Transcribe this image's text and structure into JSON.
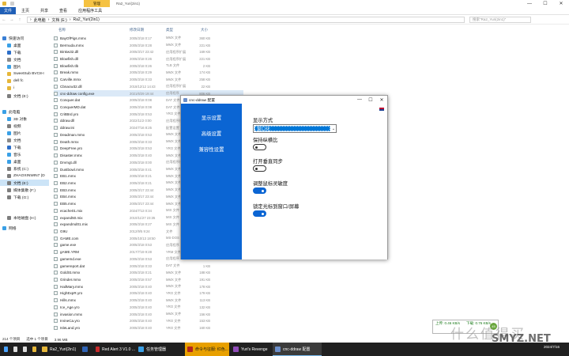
{
  "explorer": {
    "titlebar": {
      "context_tab": "管理",
      "title": "Ra2_Yuri(2in1)",
      "buttons": [
        "—",
        "☐",
        "✕"
      ]
    },
    "ribbon_tabs": [
      "文件",
      "主页",
      "共享",
      "查看",
      "应用程序工具"
    ],
    "address": {
      "back": "←",
      "forward": "→",
      "up": "↑",
      "crumbs": [
        "›",
        "此电脑",
        "›",
        "文档 (E:)",
        "›",
        "Ra2_Yuri(2in1)"
      ],
      "search_placeholder": "搜索\"Ra2_Yuri(2in1)\""
    },
    "columns": {
      "name": "名称",
      "date": "修改日期",
      "type": "类型",
      "size": "大小"
    },
    "nav": [
      {
        "label": "快速访问",
        "icon": "star-icon",
        "color": "#3a7fd5"
      },
      {
        "label": "桌面",
        "icon": "desktop-icon",
        "color": "#3aa0e6"
      },
      {
        "label": "下载",
        "icon": "download-icon",
        "color": "#2d6fc9"
      },
      {
        "label": "文档",
        "icon": "document-icon",
        "color": "#8a8a8a"
      },
      {
        "label": "图片",
        "icon": "picture-icon",
        "color": "#3aa0e6"
      },
      {
        "label": "SweetSub BVC8-I",
        "icon": "folder-icon",
        "color": "#e6b73a"
      },
      {
        "label": "dell fc",
        "icon": "folder-icon",
        "color": "#e6b73a"
      },
      {
        "label": "i",
        "icon": "folder-icon",
        "color": "#e6b73a"
      },
      {
        "label": "文档 (E:)",
        "icon": "drive-icon",
        "color": "#7d7d7d"
      },
      {
        "label": "此电脑",
        "icon": "computer-icon",
        "color": "#3aa0e6"
      },
      {
        "label": "3D 对象",
        "icon": "cube-icon",
        "color": "#3aa0e6"
      },
      {
        "label": "视频",
        "icon": "video-icon",
        "color": "#7d7d7d"
      },
      {
        "label": "图片",
        "icon": "picture-icon",
        "color": "#3aa0e6"
      },
      {
        "label": "文档",
        "icon": "document-icon",
        "color": "#8a8a8a"
      },
      {
        "label": "下载",
        "icon": "download-icon",
        "color": "#2d6fc9"
      },
      {
        "label": "音乐",
        "icon": "music-icon",
        "color": "#3aa0e6"
      },
      {
        "label": "桌面",
        "icon": "desktop-icon",
        "color": "#3aa0e6"
      },
      {
        "label": "系统 (C:)",
        "icon": "drive-icon",
        "color": "#7d7d7d"
      },
      {
        "label": "ZHAOXINWIN7 (D",
        "icon": "drive-icon",
        "color": "#7d7d7d"
      },
      {
        "label": "文档 (E:)",
        "icon": "drive-icon",
        "color": "#7d7d7d"
      },
      {
        "label": "媒体集散 (F:)",
        "icon": "drive-icon",
        "color": "#7d7d7d"
      },
      {
        "label": "下载 (G:)",
        "icon": "drive-icon",
        "color": "#7d7d7d"
      },
      {
        "label": "本地磁盘 (H:)",
        "icon": "drive-icon",
        "color": "#7d7d7d"
      },
      {
        "label": "网络",
        "icon": "network-icon",
        "color": "#3aa0e6"
      }
    ],
    "files": [
      {
        "name": "BayOfPigs.mmx",
        "date": "2005/3/18 0:17",
        "type": "MMX 文件",
        "size": "360 KB"
      },
      {
        "name": "Bermuda.mmx",
        "date": "2005/3/18 0:28",
        "type": "MMX 文件",
        "size": "221 KB"
      },
      {
        "name": "Binkw32.dll",
        "date": "2005/3/17 23:42",
        "type": "应用程序扩展",
        "size": "169 KB"
      },
      {
        "name": "Blowfish.dll",
        "date": "2005/3/18 0:26",
        "type": "应用程序扩展",
        "size": "221 KB"
      },
      {
        "name": "Blowfish.tlb",
        "date": "2005/3/18 0:26",
        "type": "TLB 文件",
        "size": "2 KB"
      },
      {
        "name": "Break.mmx",
        "date": "2005/3/18 0:29",
        "type": "MMX 文件",
        "size": "174 KB"
      },
      {
        "name": "Carville.mmx",
        "date": "2005/3/18 0:33",
        "type": "MMX 文件",
        "size": "258 KB"
      },
      {
        "name": "Cbnacw32.dll",
        "date": "2018/12/12 14:43",
        "type": "应用程序扩展",
        "size": "22 KB"
      },
      {
        "name": "cnc-ddraw config.exe",
        "date": "2021/6/29 19:44",
        "type": "应用程序",
        "size": "806 KB"
      },
      {
        "name": "Conquer.dat",
        "date": "2005/3/18 0:08",
        "type": "DAT 文件",
        "size": ""
      },
      {
        "name": "ConquerMD.dat",
        "date": "2005/3/18 0:08",
        "type": "DAT 文件",
        "size": ""
      },
      {
        "name": "CrittBrd.yro",
        "date": "2005/3/18 0:53",
        "type": "YRO 文件",
        "size": ""
      },
      {
        "name": "ddraw.dll",
        "date": "2022/11/2 0:00",
        "type": "应用程序扩展",
        "size": ""
      },
      {
        "name": "ddraw.ini",
        "date": "2024/7/16 8:25",
        "type": "配置设置",
        "size": ""
      },
      {
        "name": "Deadman.mmx",
        "date": "2005/3/18 0:53",
        "type": "MMX 文件",
        "size": ""
      },
      {
        "name": "Death.mmx",
        "date": "2005/3/18 0:33",
        "type": "MMX 文件",
        "size": ""
      },
      {
        "name": "DeepFree.yro",
        "date": "2005/3/18 0:53",
        "type": "YRO 文件",
        "size": ""
      },
      {
        "name": "Disaster.mmx",
        "date": "2005/3/18 0:40",
        "type": "MMX 文件",
        "size": ""
      },
      {
        "name": "Drvmgt.dll",
        "date": "2005/3/18 0:00",
        "type": "应用程序扩展",
        "size": ""
      },
      {
        "name": "Dustbowl.mmx",
        "date": "2005/3/18 0:41",
        "type": "MMX 文件",
        "size": ""
      },
      {
        "name": "EB1.mmx",
        "date": "2005/3/18 0:21",
        "type": "MMX 文件",
        "size": ""
      },
      {
        "name": "EB2.mmx",
        "date": "2005/3/18 0:21",
        "type": "MMX 文件",
        "size": ""
      },
      {
        "name": "EB3.mmx",
        "date": "2005/3/17 23:44",
        "type": "MMX 文件",
        "size": ""
      },
      {
        "name": "EB4.mmx",
        "date": "2005/3/17 23:44",
        "type": "MMX 文件",
        "size": ""
      },
      {
        "name": "EB5.mmx",
        "date": "2005/3/17 23:44",
        "type": "MMX 文件",
        "size": ""
      },
      {
        "name": "ecache01.mix",
        "date": "2024/7/13 0:34",
        "type": "MIX 文件",
        "size": ""
      },
      {
        "name": "expand50.mix",
        "date": "2010/11/27 23:35",
        "type": "MIX 文件",
        "size": ""
      },
      {
        "name": "expandmd01.mix",
        "date": "2005/3/18 0:27",
        "type": "MIX 文件",
        "size": ""
      },
      {
        "name": "G9U",
        "date": "2012/9/5 9:24",
        "type": "文件",
        "size": ""
      },
      {
        "name": "GAME.com",
        "date": "2005/10/13 18:50",
        "type": "MS-DOS 应用程序",
        "size": ""
      },
      {
        "name": "game.exe",
        "date": "2005/3/18 0:53",
        "type": "应用程序",
        "size": ""
      },
      {
        "name": "gAME.YRM",
        "date": "2017/7/19 9:28",
        "type": "YRM 文件",
        "size": ""
      },
      {
        "name": "gamemd.exe",
        "date": "2005/3/18 0:53",
        "type": "应用程序",
        "size": ""
      },
      {
        "name": "gamereport.dat",
        "date": "2005/3/18 0:33",
        "type": "DAT 文件",
        "size": "1 KB"
      },
      {
        "name": "GoldSt.mmx",
        "date": "2005/3/18 0:21",
        "type": "MMX 文件",
        "size": "188 KB"
      },
      {
        "name": "Grinder.mmx",
        "date": "2005/3/18 0:57",
        "type": "MMX 文件",
        "size": "191 KB"
      },
      {
        "name": "HailMary.mmx",
        "date": "2005/3/18 0:40",
        "type": "MMX 文件",
        "size": "178 KB"
      },
      {
        "name": "HighExpR.yro",
        "date": "2005/3/18 0:40",
        "type": "YRO 文件",
        "size": "179 KB"
      },
      {
        "name": "Hills.mmx",
        "date": "2005/3/18 0:40",
        "type": "MMX 文件",
        "size": "113 KB"
      },
      {
        "name": "Ice_Age.yro",
        "date": "2005/3/18 0:40",
        "type": "YRO 文件",
        "size": "132 KB"
      },
      {
        "name": "invasion.mmx",
        "date": "2005/3/18 0:40",
        "type": "MMX 文件",
        "size": "156 KB"
      },
      {
        "name": "IrvineCa.yro",
        "date": "2005/3/18 0:40",
        "type": "YRO 文件",
        "size": "153 KB"
      },
      {
        "name": "IsleLand.yro",
        "date": "2005/3/18 0:40",
        "type": "YRO 文件",
        "size": "160 KB"
      }
    ],
    "status": {
      "count": "214 个项目",
      "selected": "选中 1 个项目",
      "size": "3.96 MB"
    }
  },
  "dialog": {
    "title": "cnc-ddraw 配置",
    "buttons": [
      "—",
      "☐",
      "✕"
    ],
    "tabs": [
      "显示设置",
      "高级设置",
      "兼容性设置"
    ],
    "display_mode": {
      "label": "显示方式",
      "value": "窗口化",
      "arrow": "⌄"
    },
    "options": [
      {
        "label": "保持纵横比",
        "on": false
      },
      {
        "label": "打开垂直同步",
        "on": false
      },
      {
        "label": "调整鼠标灵敏度",
        "on": true
      },
      {
        "label": "锁定光标到窗口/屏幕",
        "on": true
      }
    ],
    "accent": "#0b65d3"
  },
  "tray_popup": {
    "up": "上传: 0.46 KB/s",
    "down": "下载: 0.76 KB/s",
    "badge": "45"
  },
  "watermark": {
    "cn": "什么值得买",
    "en": "SMYZ.NET"
  },
  "taskbar": {
    "items": [
      {
        "label": "",
        "icon": "start-icon",
        "color": "#4aa3ff"
      },
      {
        "label": "",
        "icon": "search-icon",
        "color": "#dddddd"
      },
      {
        "label": "",
        "icon": "taskview-icon",
        "color": "#dddddd"
      },
      {
        "label": "",
        "icon": "folder-icon",
        "color": "#e6b73a"
      },
      {
        "label": "Ra2_Yuri(2in1)",
        "icon": "explorer-icon",
        "color": "#e6b73a"
      },
      {
        "label": "",
        "icon": "word-icon",
        "color": "#2f63b5"
      },
      {
        "label": "Red Alert 3 V1.0 ...",
        "icon": "ra3-icon",
        "color": "#c72a2a"
      },
      {
        "label": "任务管理器",
        "icon": "taskmgr-icon",
        "color": "#3aa0e6"
      },
      {
        "label": "命令与征服: 红色...",
        "icon": "game-icon",
        "color": "#b3261e"
      },
      {
        "label": "Yuri's Revenge",
        "icon": "yuri-icon",
        "color": "#8f4bb8"
      },
      {
        "label": "cnc-ddraw 配置",
        "icon": "ddraw-icon",
        "color": "#6b8ec9"
      }
    ],
    "clock_time": "",
    "clock_date": "2024/7/16"
  }
}
